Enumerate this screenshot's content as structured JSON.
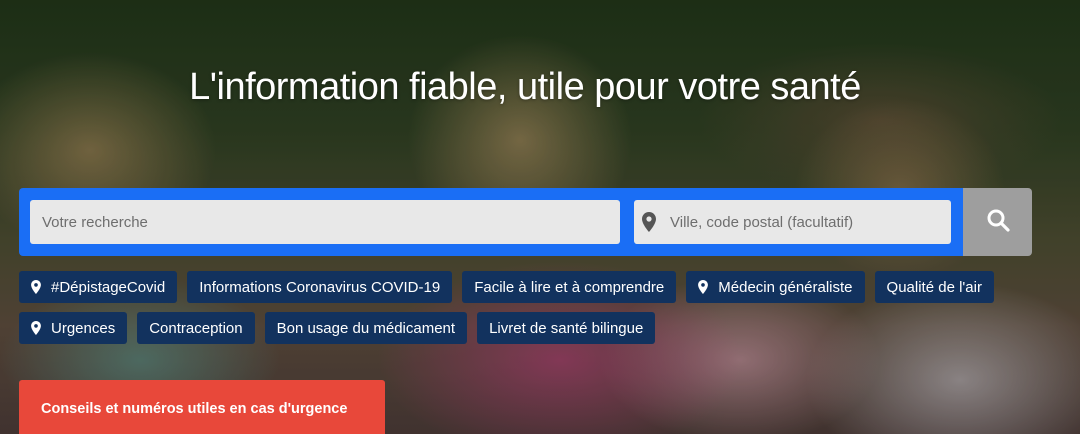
{
  "hero": {
    "title": "L'information fiable, utile pour votre santé"
  },
  "search": {
    "query_placeholder": "Votre recherche",
    "location_placeholder": "Ville, code postal (facultatif)",
    "button_icon": "search-icon"
  },
  "tags": {
    "row1": [
      {
        "label": "#DépistageCovid",
        "icon": "location-pin-icon"
      },
      {
        "label": "Informations Coronavirus COVID-19"
      },
      {
        "label": "Facile à lire et à comprendre"
      },
      {
        "label": "Médecin généraliste",
        "icon": "location-pin-icon"
      },
      {
        "label": "Qualité de l'air"
      }
    ],
    "row2": [
      {
        "label": "Urgences",
        "icon": "location-pin-icon"
      },
      {
        "label": "Contraception"
      },
      {
        "label": "Bon usage du médicament"
      },
      {
        "label": "Livret de santé bilingue"
      }
    ]
  },
  "emergency": {
    "label": "Conseils et numéros utiles en cas d'urgence"
  },
  "colors": {
    "search_bar": "#1a6ef5",
    "tag_background": "#12325e",
    "search_button": "#9e9e9e",
    "emergency_button": "#e8483a"
  }
}
